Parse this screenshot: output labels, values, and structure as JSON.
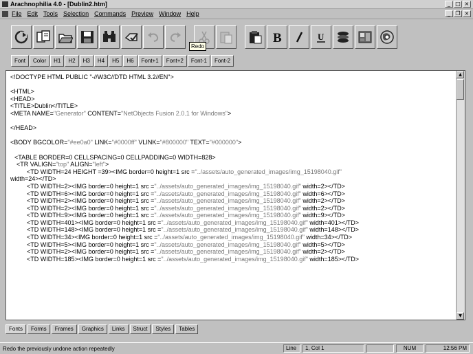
{
  "window": {
    "title": "Arachnophilia 4.0 - [Dublin2.htm]"
  },
  "menu": [
    "File",
    "Edit",
    "Tools",
    "Selection",
    "Commands",
    "Preview",
    "Window",
    "Help"
  ],
  "toolbar": {
    "tooltip": "Redo",
    "buttons": [
      "copy-page-icon",
      "copy-icon",
      "open-icon",
      "save-icon",
      "find-icon",
      "spellcheck-icon",
      "undo-icon",
      "redo-icon",
      "cut-icon",
      "paste-icon",
      "clipboard-icon",
      "bold-icon",
      "italic-icon",
      "underline-icon",
      "list-icon",
      "image-icon",
      "browser-icon"
    ]
  },
  "tag_toolbar": [
    "Font",
    "Color",
    "H1",
    "H2",
    "H3",
    "H4",
    "H5",
    "H6",
    "Font+1",
    "Font+2",
    "Font-1",
    "Font-2"
  ],
  "code": {
    "line1": "<!DOCTYPE HTML PUBLIC \"-//W3C//DTD HTML 3.2//EN\">",
    "line2": "<HTML>",
    "line3": "<HEAD>",
    "line4a": "<TITLE>",
    "line4b": "Dublin",
    "line4c": "</TITLE>",
    "line5a": "<META NAME=",
    "line5b": "\"Generator\"",
    "line5c": " CONTENT=",
    "line5d": "\"NetObjects Fusion 2.0.1 for Windows\"",
    "line5e": ">",
    "line6": "</HEAD>",
    "line7a": "<BODY BGCOLOR=",
    "line7b": "\"#ee0a0\"",
    "line7c": " LINK=",
    "line7d": "\"#0000ff\"",
    "line7e": " VLINK=",
    "line7f": "\"#800000\"",
    "line7g": " TEXT=",
    "line7h": "\"#000000\"",
    "line7i": ">",
    "line8": "<TABLE BORDER=0 CELLSPACING=0 CELLPADDING=0 WIDTH=828>",
    "line9a": "<TR VALIGN=",
    "line9b": "\"top\"",
    "line9c": " ALIGN=",
    "line9d": "\"left\"",
    "line9e": ">",
    "line10a": "<TD WIDTH=24 HEIGHT =39><IMG border=0 height=1 src =",
    "line10b": "\"../assets/auto_generated_images/img_15198040.gif\"",
    "line11": "width=24></TD>",
    "rows": [
      {
        "w": "2",
        "tail": "width=2></TD>"
      },
      {
        "w": "6",
        "tail": "width=6></TD>"
      },
      {
        "w": "2",
        "tail": "width=2></TD>"
      },
      {
        "w": "2",
        "tail": "width=2></TD>"
      },
      {
        "w": "9",
        "tail": "width=9></TD>"
      },
      {
        "w": "401",
        "tail": "width=401></TD>"
      },
      {
        "w": "148",
        "tail": "width=148></TD>"
      },
      {
        "w": "34",
        "tail": "width=34></TD>"
      },
      {
        "w": "5",
        "tail": "width=5></TD>"
      },
      {
        "w": "2",
        "tail": "width=2></TD>"
      },
      {
        "w": "185",
        "tail": "width=185></TD>"
      }
    ],
    "row_prefix": "<TD WIDTH=",
    "row_mid": "><IMG border=0 height=1 src =",
    "row_src": "\"../assets/auto_generated_images/img_15198040.gif\""
  },
  "tabs": [
    "Fonts",
    "Forms",
    "Frames",
    "Graphics",
    "Links",
    "Struct",
    "Styles",
    "Tables"
  ],
  "status": {
    "message": "Redo the previously undone action repeatedly",
    "line_label": "Line",
    "line_col": "1, Col   1",
    "num": "NUM",
    "time": "12:56 PM"
  }
}
